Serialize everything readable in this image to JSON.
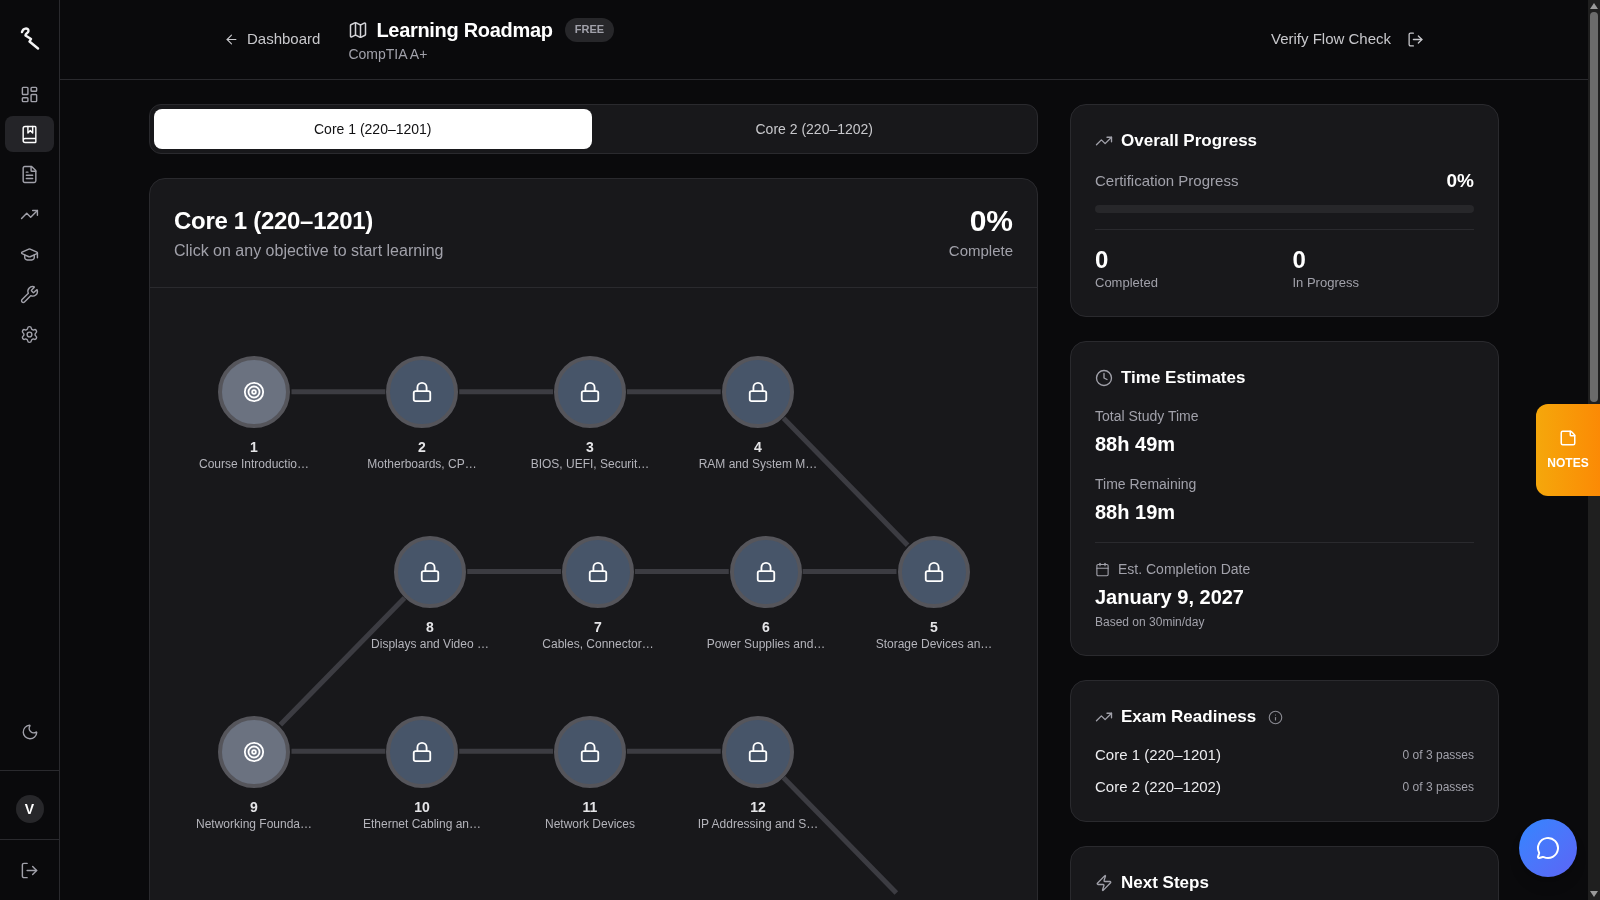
{
  "sidebar": {
    "nav_items": [
      {
        "selected": false
      },
      {
        "selected": true
      },
      {
        "selected": false
      },
      {
        "selected": false
      },
      {
        "selected": false
      },
      {
        "selected": false
      },
      {
        "selected": false
      }
    ],
    "avatar": "V"
  },
  "header": {
    "back_link": "Dashboard",
    "title": "Learning Roadmap",
    "badge": "FREE",
    "subtitle": "CompTIA A+",
    "user_name": "Verify Flow Check"
  },
  "tabs": [
    {
      "label": "Core 1 (220–1201)",
      "selected": true
    },
    {
      "label": "Core 2 (220–1202)",
      "selected": false
    }
  ],
  "roadmap": {
    "title": "Core 1 (220–1201)",
    "subtitle": "Click on any objective to start learning",
    "percent": "0%",
    "percent_label": "Complete",
    "rows": [
      {
        "nodes": [
          {
            "number": "1",
            "label": "Course Introductio…",
            "locked": false
          },
          {
            "number": "2",
            "label": "Motherboards, CP…",
            "locked": true
          },
          {
            "number": "3",
            "label": "BIOS, UEFI, Securit…",
            "locked": true
          },
          {
            "number": "4",
            "label": "RAM and System M…",
            "locked": true
          }
        ]
      },
      {
        "nodes": [
          {
            "number": "8",
            "label": "Displays and Video …",
            "locked": true
          },
          {
            "number": "7",
            "label": "Cables, Connector…",
            "locked": true
          },
          {
            "number": "6",
            "label": "Power Supplies and…",
            "locked": true
          },
          {
            "number": "5",
            "label": "Storage Devices an…",
            "locked": true
          }
        ]
      },
      {
        "nodes": [
          {
            "number": "9",
            "label": "Networking Founda…",
            "locked": false
          },
          {
            "number": "10",
            "label": "Ethernet Cabling an…",
            "locked": true
          },
          {
            "number": "11",
            "label": "Network Devices",
            "locked": true
          },
          {
            "number": "12",
            "label": "IP Addressing and S…",
            "locked": true
          }
        ]
      }
    ],
    "more_below": true
  },
  "overall_progress": {
    "title": "Overall Progress",
    "label": "Certification Progress",
    "value": "0%",
    "level": 0,
    "stats": [
      {
        "value": "0",
        "label": "Completed"
      },
      {
        "value": "0",
        "label": "In Progress"
      }
    ]
  },
  "time_estimates": {
    "title": "Time Estimates",
    "items": [
      {
        "label": "Total Study Time",
        "value": "88h 49m"
      },
      {
        "label": "Time Remaining",
        "value": "88h 19m"
      }
    ],
    "completion": {
      "label": "Est. Completion Date",
      "value": "January 9, 2027",
      "note": "Based on 30min/day"
    }
  },
  "exam_readiness": {
    "title": "Exam Readiness",
    "rows": [
      {
        "label": "Core 1 (220–1201)",
        "value": "0 of 3 passes"
      },
      {
        "label": "Core 2 (220–1202)",
        "value": "0 of 3 passes"
      }
    ]
  },
  "next_steps": {
    "title": "Next Steps"
  },
  "notes_tab": {
    "label": "NOTES"
  }
}
